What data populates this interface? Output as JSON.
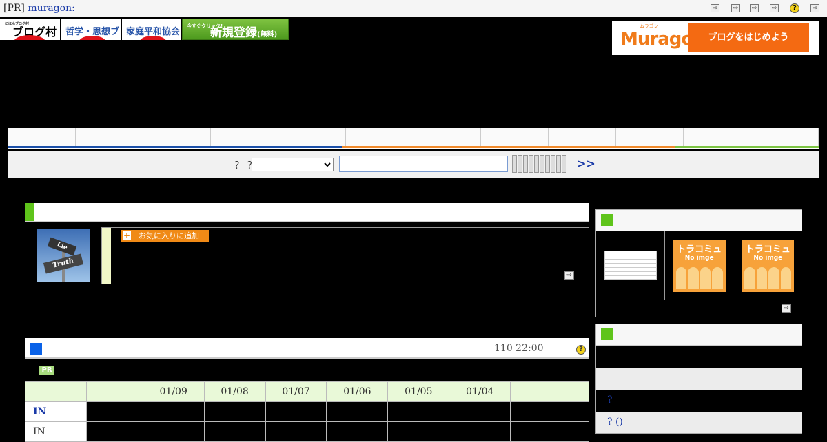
{
  "topbar": {
    "pr_label": "[PR]",
    "pr_link": "muragon:",
    "icons": [
      "arrow-icon",
      "arrow-icon",
      "arrow-icon",
      "arrow-icon",
      "arrow-icon",
      "help-icon"
    ]
  },
  "banners": {
    "blogmura_small": "にほんブログ村",
    "blogmura": "ブログ村",
    "philosophy": "哲学・思想ブログ",
    "family_peace": "家庭平和協会",
    "register_small": "今すぐクリック!",
    "register": "新規登録",
    "register_paren": "(無料)"
  },
  "muragon": {
    "kana": "ムラゴン",
    "logo": "Muragon",
    "cta": "ブログをはじめよう"
  },
  "nav": {
    "tab_count": 12,
    "line_colors": [
      "#1b4fa8",
      "#f08a2c",
      "#7cc443"
    ]
  },
  "search": {
    "label": "？ ？",
    "select_value": "",
    "input_value": "",
    "go": ">>"
  },
  "profile": {
    "avatar_sign_top": "Lie",
    "avatar_sign_bottom": "Truth",
    "favorite_plus": "+",
    "favorite_label": "お気に入りに追加"
  },
  "ranking": {
    "date": "110 22:00",
    "help": "?",
    "pr": "PR",
    "dates": [
      "01/09",
      "01/08",
      "01/07",
      "01/06",
      "01/05",
      "01/04"
    ],
    "rows": [
      {
        "label": "IN"
      },
      {
        "label": "IN"
      }
    ]
  },
  "tracomi": {
    "noimg_title": "トラコミュ",
    "noimg_sub": "No imge"
  },
  "community": {
    "rows": [
      "?",
      "? ()"
    ]
  },
  "colors": {
    "accent_green": "#5fc41b",
    "accent_blue": "#0a62e8",
    "orange": "#f08a16",
    "link_blue": "#1a3aa8"
  }
}
